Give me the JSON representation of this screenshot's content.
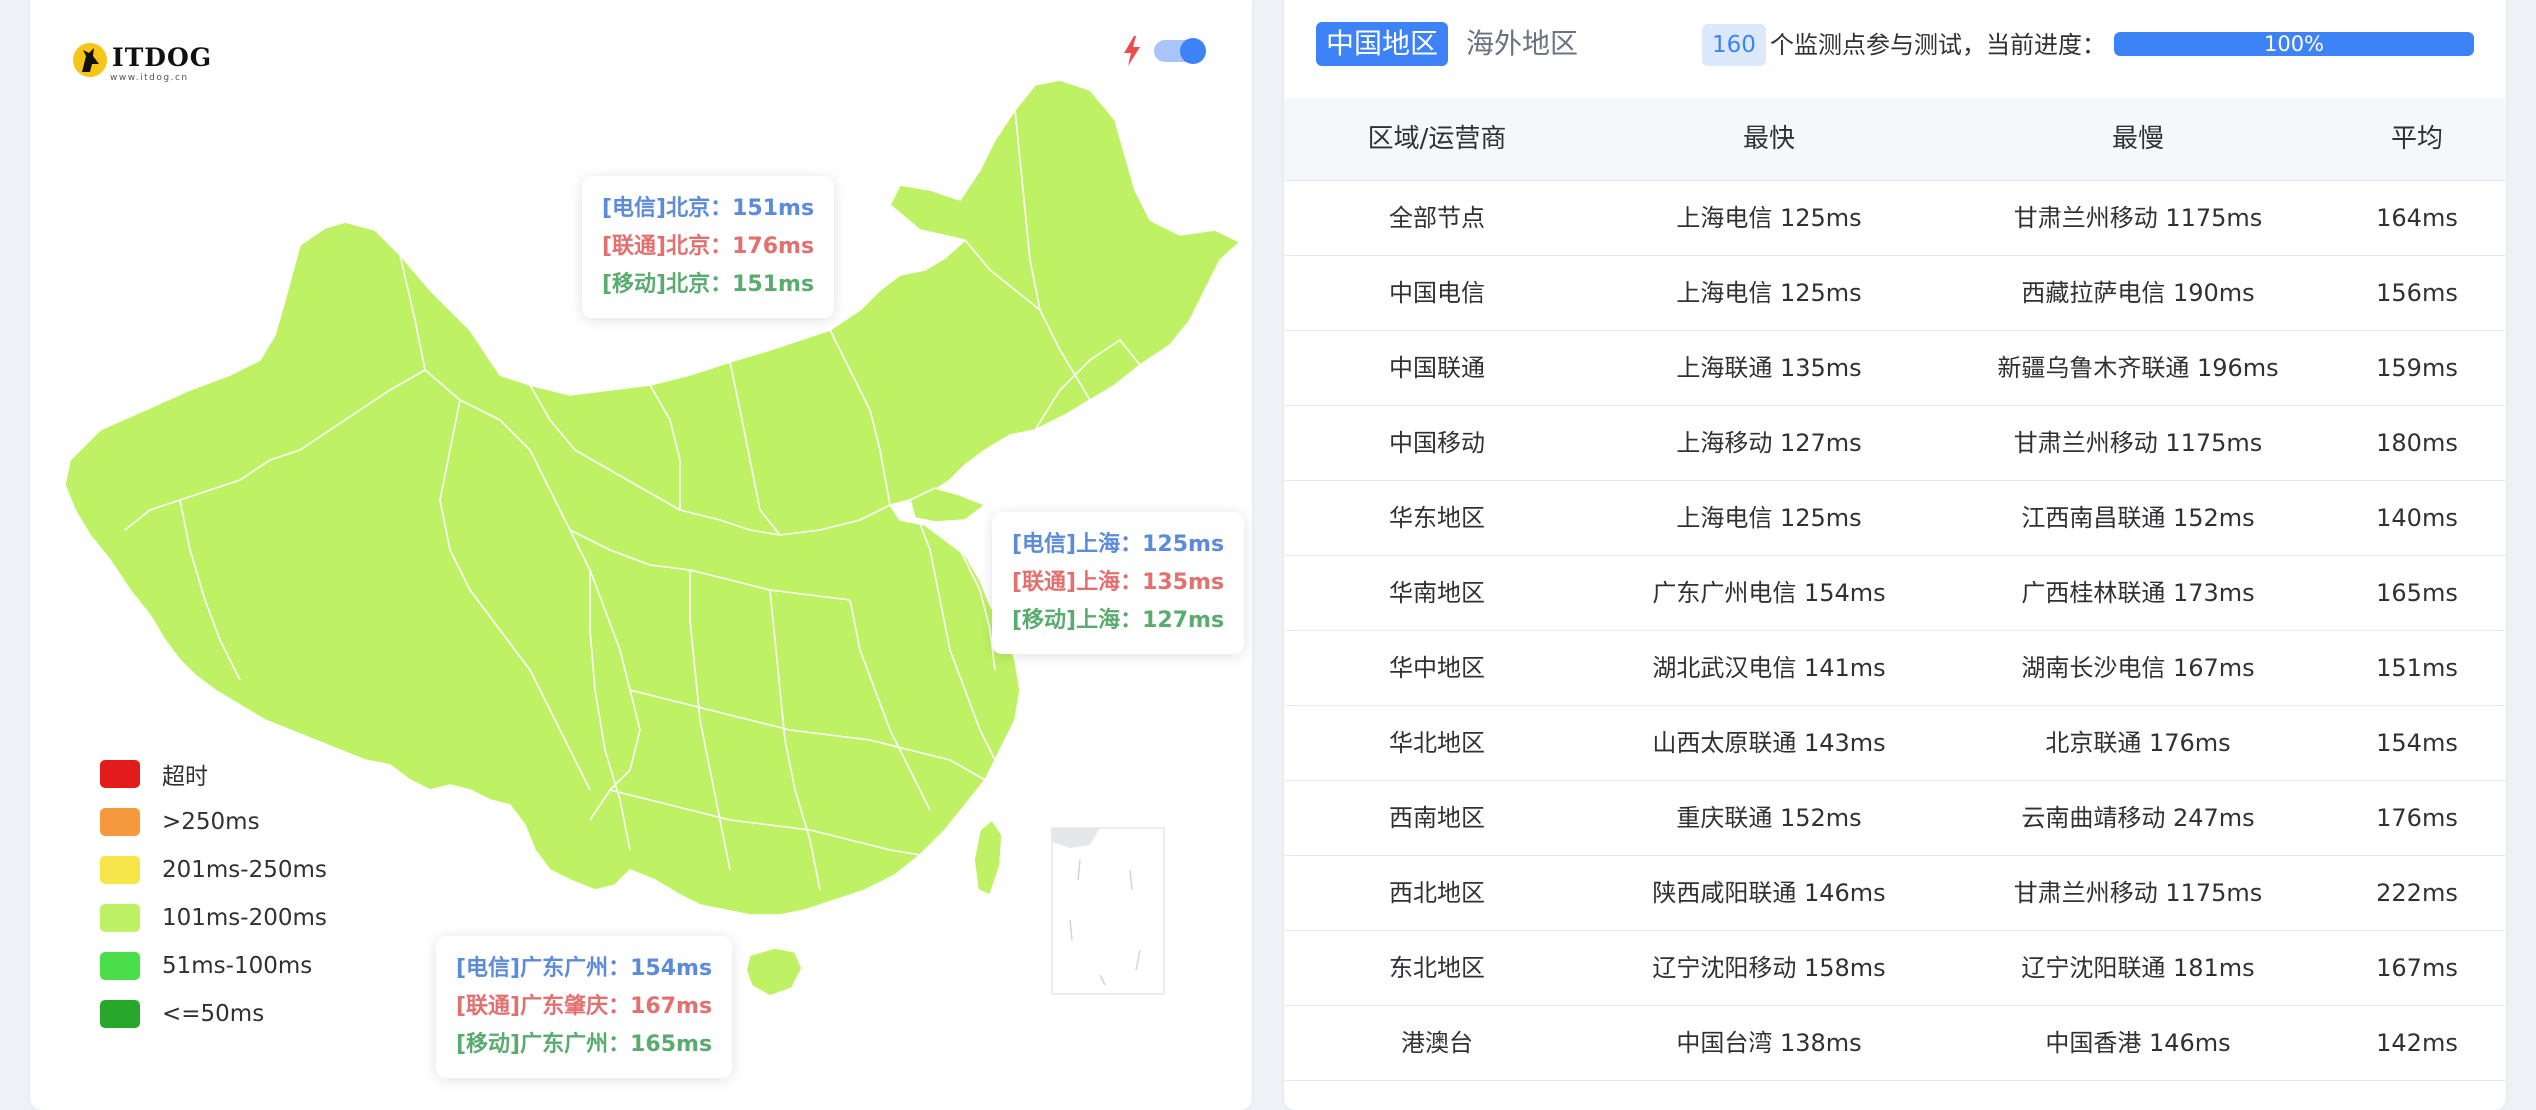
{
  "logo": {
    "text": "ITDOG",
    "sub": "www.itdog.cn"
  },
  "colors": {
    "map_fill": "#bef264",
    "accent": "#3e82f7",
    "timeout": "#e31b1b",
    "over250": "#f59a3c",
    "r201_250": "#f7e64a",
    "r101_200": "#bef264",
    "r51_100": "#4ade4a",
    "le50": "#27a82a"
  },
  "tooltips": {
    "beijing": {
      "ct": "[电信]北京：151ms",
      "cu": "[联通]北京：176ms",
      "cm": "[移动]北京：151ms"
    },
    "shanghai": {
      "ct": "[电信]上海：125ms",
      "cu": "[联通]上海：135ms",
      "cm": "[移动]上海：127ms"
    },
    "guangdong": {
      "ct": "[电信]广东广州：154ms",
      "cu": "[联通]广东肇庆：167ms",
      "cm": "[移动]广东广州：165ms"
    }
  },
  "legend": [
    {
      "label": "超时",
      "color": "#e31b1b",
      "icon": "timeout-swatch"
    },
    {
      "label": ">250ms",
      "color": "#f59a3c",
      "icon": "over250-swatch"
    },
    {
      "label": "201ms-250ms",
      "color": "#f7e64a",
      "icon": "r201-250-swatch"
    },
    {
      "label": "101ms-200ms",
      "color": "#bef264",
      "icon": "r101-200-swatch"
    },
    {
      "label": "51ms-100ms",
      "color": "#4ade4a",
      "icon": "r51-100-swatch"
    },
    {
      "label": "<=50ms",
      "color": "#27a82a",
      "icon": "le50-swatch"
    }
  ],
  "header": {
    "tab_cn": "中国地区",
    "tab_overseas": "海外地区",
    "monitor_count": "160",
    "progress_text": "个监测点参与测试，当前进度：",
    "progress_label": "100%",
    "progress_value": 1.0
  },
  "table": {
    "columns": [
      "区域/运营商",
      "最快",
      "最慢",
      "平均"
    ],
    "rows": [
      [
        "全部节点",
        "上海电信 125ms",
        "甘肃兰州移动 1175ms",
        "164ms"
      ],
      [
        "中国电信",
        "上海电信 125ms",
        "西藏拉萨电信 190ms",
        "156ms"
      ],
      [
        "中国联通",
        "上海联通 135ms",
        "新疆乌鲁木齐联通 196ms",
        "159ms"
      ],
      [
        "中国移动",
        "上海移动 127ms",
        "甘肃兰州移动 1175ms",
        "180ms"
      ],
      [
        "华东地区",
        "上海电信 125ms",
        "江西南昌联通 152ms",
        "140ms"
      ],
      [
        "华南地区",
        "广东广州电信 154ms",
        "广西桂林联通 173ms",
        "165ms"
      ],
      [
        "华中地区",
        "湖北武汉电信 141ms",
        "湖南长沙电信 167ms",
        "151ms"
      ],
      [
        "华北地区",
        "山西太原联通 143ms",
        "北京联通 176ms",
        "154ms"
      ],
      [
        "西南地区",
        "重庆联通 152ms",
        "云南曲靖移动 247ms",
        "176ms"
      ],
      [
        "西北地区",
        "陕西咸阳联通 146ms",
        "甘肃兰州移动 1175ms",
        "222ms"
      ],
      [
        "东北地区",
        "辽宁沈阳移动 158ms",
        "辽宁沈阳联通 181ms",
        "167ms"
      ],
      [
        "港澳台",
        "中国台湾 138ms",
        "中国香港 146ms",
        "142ms"
      ]
    ]
  }
}
